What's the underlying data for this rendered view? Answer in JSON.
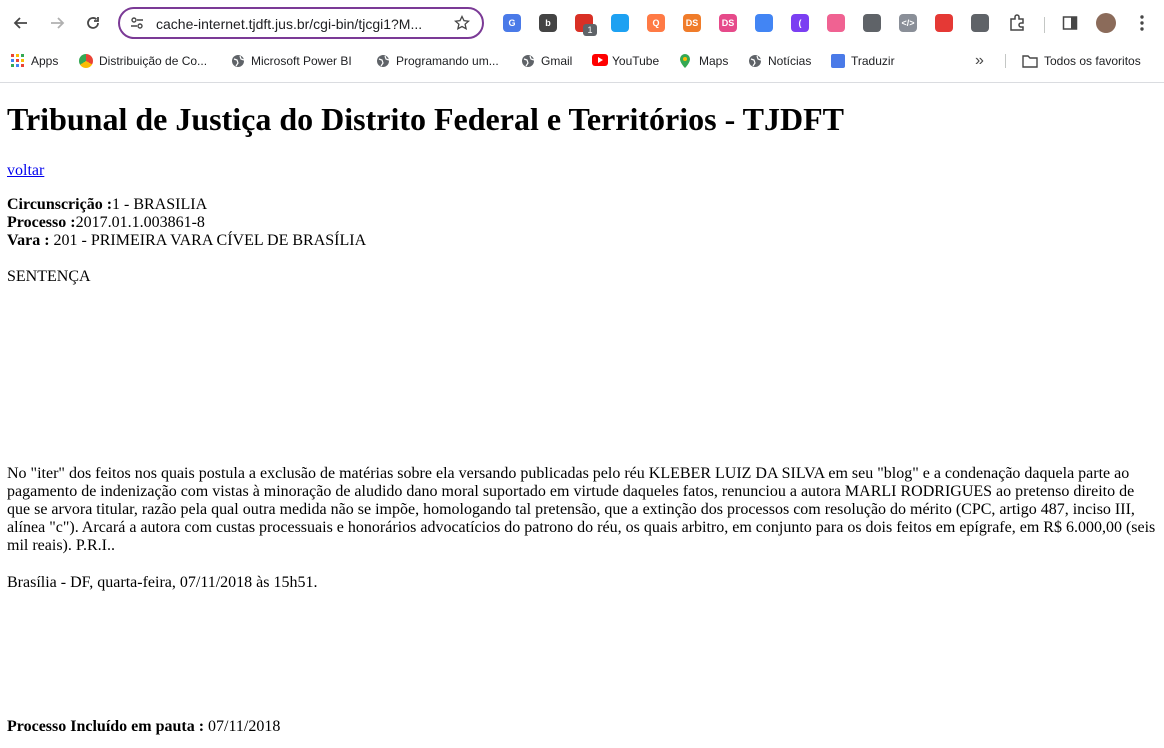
{
  "browser": {
    "url": "cache-internet.tjdft.jus.br/cgi-bin/tjcgi1?M...",
    "extensions": [
      {
        "name": "translate-icon",
        "color": "#4a7ae8",
        "label": "G"
      },
      {
        "name": "b-icon",
        "color": "#444444",
        "label": "b"
      },
      {
        "name": "red-badge-icon",
        "color": "#d93025",
        "label": ""
      },
      {
        "name": "bird-icon",
        "color": "#1da1f2",
        "label": ""
      },
      {
        "name": "q-icon",
        "color": "#ff7a45",
        "label": "Q"
      },
      {
        "name": "ds-icon",
        "color": "#f07c2a",
        "label": "DS"
      },
      {
        "name": "ds-circle-icon",
        "color": "#e64a8a",
        "label": "DS"
      },
      {
        "name": "tag-icon",
        "color": "#4285f4",
        "label": ""
      },
      {
        "name": "bracket-icon",
        "color": "#7b3ff2",
        "label": "("
      },
      {
        "name": "arrow-icon",
        "color": "#f06292",
        "label": ""
      },
      {
        "name": "gear-mix-icon",
        "color": "#5f6368",
        "label": ""
      },
      {
        "name": "code-icon",
        "color": "#8a8f98",
        "label": "</>"
      },
      {
        "name": "download-icon",
        "color": "#e53935",
        "label": ""
      },
      {
        "name": "camera-icon",
        "color": "#5f6368",
        "label": ""
      }
    ],
    "extension_badge": "1",
    "bookmarks": [
      {
        "name": "apps",
        "label": "Apps"
      },
      {
        "name": "distribuicao",
        "label": "Distribuição de Co..."
      },
      {
        "name": "powerbi",
        "label": "Microsoft Power BI"
      },
      {
        "name": "programando",
        "label": "Programando um..."
      },
      {
        "name": "gmail",
        "label": "Gmail"
      },
      {
        "name": "youtube",
        "label": "YouTube"
      },
      {
        "name": "maps",
        "label": "Maps"
      },
      {
        "name": "noticias",
        "label": "Notícias"
      },
      {
        "name": "traduzir",
        "label": "Traduzir"
      }
    ],
    "more_bookmarks": "»",
    "all_bookmarks": "Todos os favoritos"
  },
  "page": {
    "title": "Tribunal de Justiça do Distrito Federal e Territórios - TJDFT",
    "back_link": "voltar",
    "circ_label": "Circunscrição :",
    "circ_value": "1 - BRASILIA",
    "proc_label": "Processo :",
    "proc_value": "2017.01.1.003861-8",
    "vara_label": "Vara :",
    "vara_value": " 201 - PRIMEIRA VARA CÍVEL DE BRASÍLIA",
    "doc_type": "SENTENÇA",
    "body": "No \"iter\" dos feitos nos quais postula a exclusão de matérias sobre ela versando publicadas pelo réu KLEBER LUIZ DA SILVA em seu \"blog\" e a condenação daquela parte ao pagamento de indenização com vistas à minoração de aludido dano moral suportado em virtude daqueles fatos, renunciou a autora MARLI RODRIGUES ao pretenso direito de que se arvora titular, razão pela qual outra medida não se impõe, homologando tal pretensão, que a extinção dos processos com resolução do mérito (CPC, artigo 487, inciso III, alínea \"c\"). Arcará a autora com custas processuais e honorários advocatícios do patrono do réu, os quais arbitro, em conjunto para os dois feitos em epígrafe, em R$ 6.000,00 (seis mil reais). P.R.I..",
    "date_line": "Brasília - DF, quarta-feira, 07/11/2018 às 15h51.",
    "pauta_label": "Processo Incluído em pauta :",
    "pauta_value": " 07/11/2018"
  }
}
